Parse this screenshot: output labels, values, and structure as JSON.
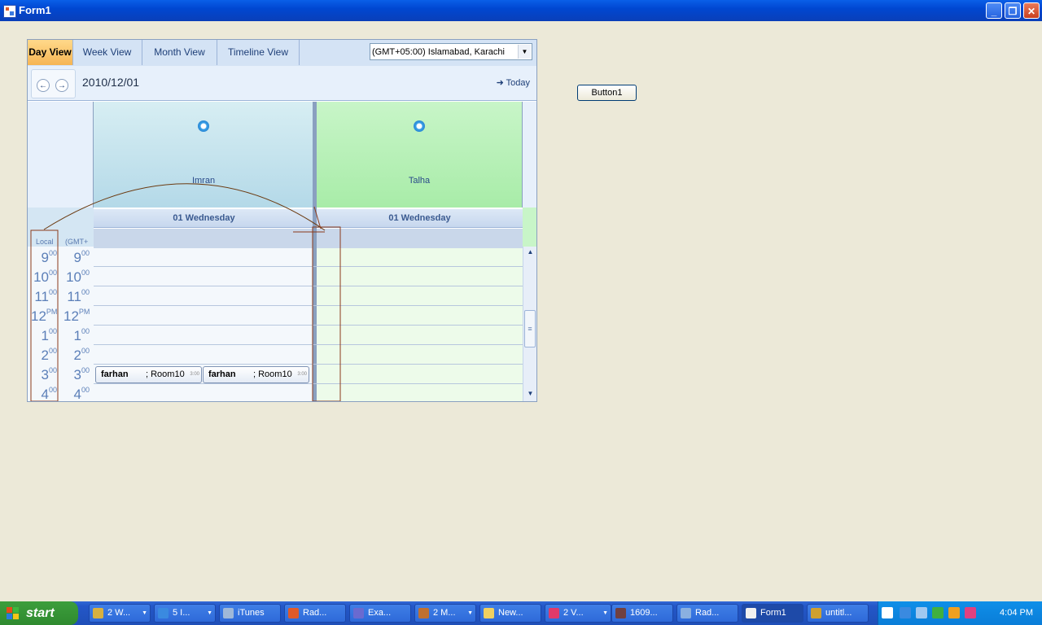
{
  "window": {
    "title": "Form1"
  },
  "scheduler": {
    "views": [
      "Day View",
      "Week View",
      "Month View",
      "Timeline View"
    ],
    "timezone": "(GMT+05:00) Islamabad, Karachi",
    "date": "2010/12/01",
    "today_label": "Today",
    "resources": [
      "Imran",
      "Talha"
    ],
    "day_headers": [
      "01 Wednesday",
      "01 Wednesday"
    ],
    "tz_headers": [
      "Local",
      "(GMT+"
    ],
    "hours": [
      {
        "h": "9",
        "s": "00"
      },
      {
        "h": "10",
        "s": "00"
      },
      {
        "h": "11",
        "s": "00"
      },
      {
        "h": "12",
        "s": "PM"
      },
      {
        "h": "1",
        "s": "00"
      },
      {
        "h": "2",
        "s": "00"
      },
      {
        "h": "3",
        "s": "00"
      },
      {
        "h": "4",
        "s": "00"
      }
    ],
    "appointments": [
      {
        "who": "farhan",
        "room": "; Room10",
        "time": "3:00"
      },
      {
        "who": "farhan",
        "room": "; Room10",
        "time": "3:00"
      }
    ],
    "colors": {
      "imran_column": "#c5e3ec",
      "talha_column": "#b4f0b4",
      "talha_cells": "#edfbea",
      "imran_cells": "#f4f8fc"
    }
  },
  "button1": "Button1",
  "taskbar": {
    "start": "start",
    "items": [
      "2 W...",
      "5 I...",
      "iTunes",
      "Rad...",
      "Exa...",
      "2 M...",
      "New...",
      "2 V...",
      "1609...",
      "Rad...",
      "Form1",
      "untitl..."
    ],
    "clock": "4:04 PM"
  }
}
